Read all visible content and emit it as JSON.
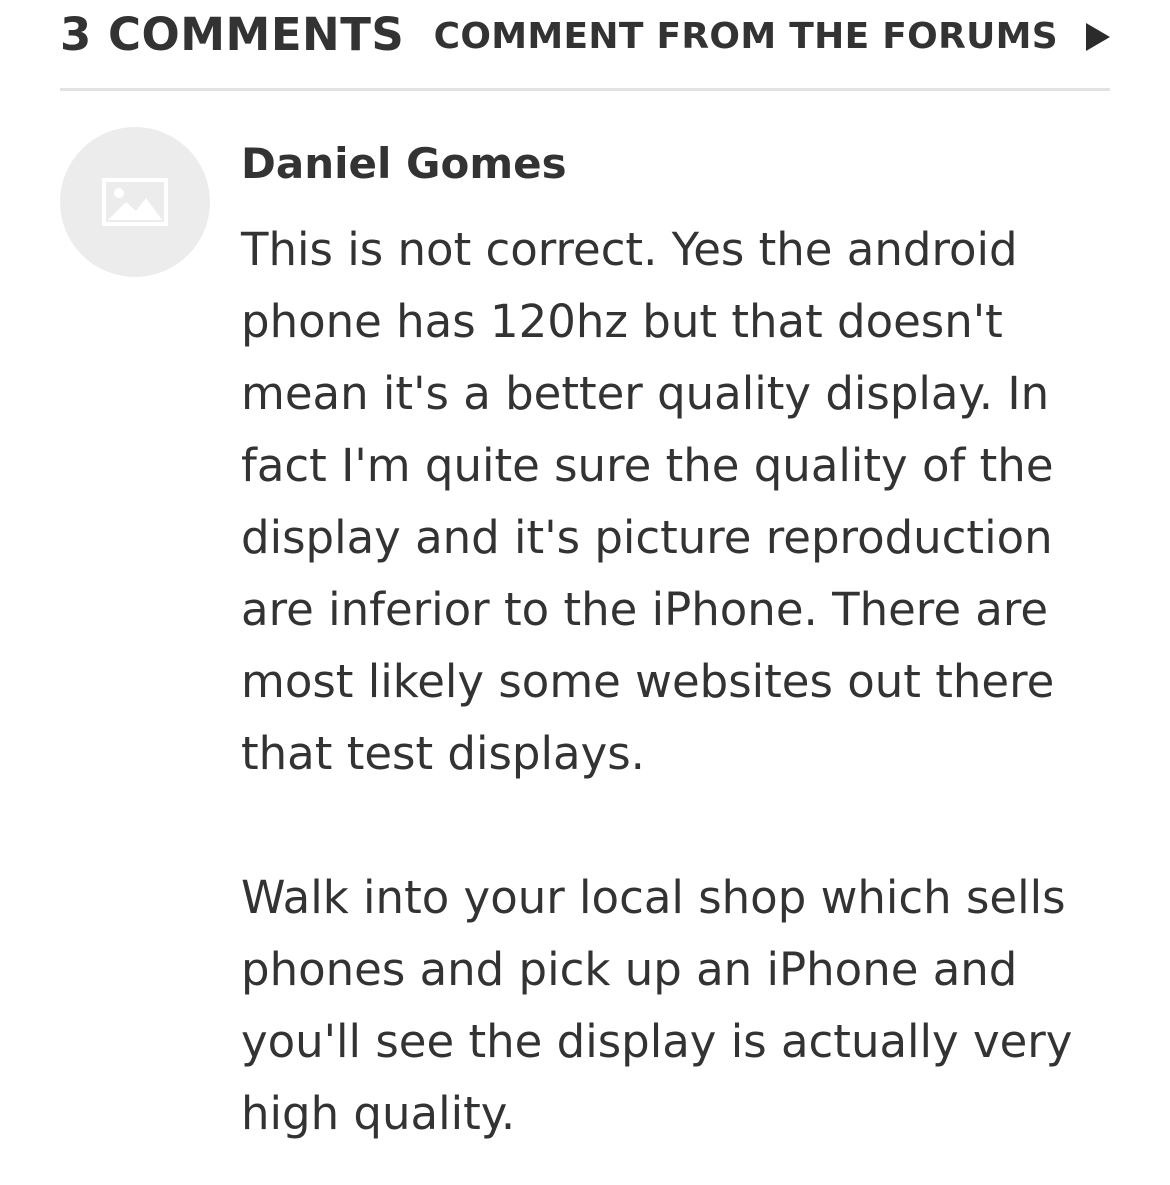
{
  "header": {
    "comment_count": "3 COMMENTS",
    "forums_link": "COMMENT FROM THE FORUMS",
    "forums_icon": "play-icon"
  },
  "comment": {
    "avatar_icon": "image-placeholder-icon",
    "author": "Daniel Gomes",
    "paragraphs": [
      {
        "lines": [
          "This is not correct. Yes the android",
          "phone has 120hz but that doesn't",
          "mean it's a better quality display. In",
          "fact I'm quite sure the quality of the",
          "display and it's picture reproduction",
          "are inferior to the iPhone. There are",
          "most likely some websites out there",
          "that test displays."
        ]
      },
      {
        "lines": [
          "Walk into your local shop which sells",
          "phones and pick up an iPhone and",
          "you'll see the display is actually very",
          "high quality."
        ]
      }
    ]
  },
  "colors": {
    "text": "#333333",
    "divider": "#e2e2e2",
    "avatar_bg": "#ececec",
    "avatar_icon": "#ffffff"
  }
}
